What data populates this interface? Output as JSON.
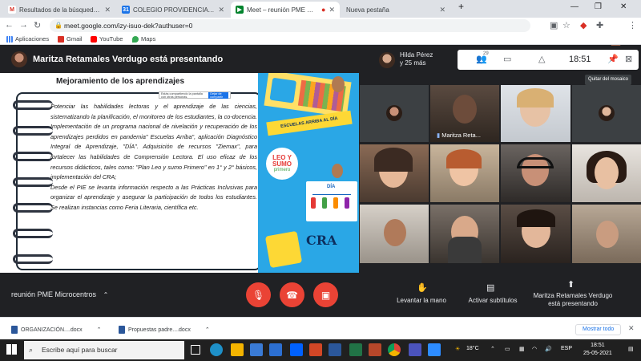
{
  "browser": {
    "tabs": [
      {
        "label": "Resultados de la búsqueda - eg...",
        "favicon": "M",
        "color": "#d93025",
        "active": false
      },
      {
        "label": "COLEGIO PROVIDENCIA - Calend...",
        "favicon": "31",
        "color": "#1a73e8",
        "active": false
      },
      {
        "label": "Meet – reunión PME Microce",
        "favicon": "▶",
        "color": "#00832d",
        "active": true
      },
      {
        "label": "Nueva pestaña",
        "favicon": "",
        "color": "#dadce0",
        "active": false
      }
    ],
    "new_tab": "+",
    "url": "meet.google.com/izy-isuo-dek?authuser=0",
    "bookmarks": [
      {
        "label": "Aplicaciones",
        "color": "#4285f4"
      },
      {
        "label": "Gmail",
        "color": "#d93025"
      },
      {
        "label": "YouTube",
        "color": "#ff0000"
      },
      {
        "label": "Maps",
        "color": "#34a853"
      }
    ]
  },
  "meet": {
    "presenter_banner": "Maritza Retamales Verdugo está presentando",
    "top_participant": {
      "name": "Hilda Pérez",
      "more": "y 25 más"
    },
    "people_count": "29",
    "clock": "18:51",
    "tooltip": "Quitar del mosaico",
    "tile_label": "Maritza Reta...",
    "meeting_name": "reunión PME Microcentros",
    "controls": {
      "raise_hand": "Levantar la mano",
      "captions": "Activar subtítulos",
      "presenting": "Maritza Retamales Verdugo está presentando"
    }
  },
  "slide": {
    "title": "Mejoramiento de los aprendizajes",
    "share_text": "Estás compartiendo la pantalla con otras personas.",
    "share_button": "Dejar de compartir",
    "paragraph_1": "Potenciar las habilidades lectoras y el aprendizaje de las ciencias, sistematizando la planificación, el monitoreo de los estudiantes, la co-docencia. Implementación de un programa nacional de nivelación y recuperación de los aprendizajes perdidos en pandemia\" Escuelas Arriba\", aplicación Diagnóstico Integral de Aprendizaje, \"DÍA\". Adquisición de recursos \"Ziemax\", para fortalecer las habilidades de Comprensión Lectora. El uso eficaz de los recursos didácticos, tales como: \"Plan Leo y sumo Primero\" en 1° y 2° básicos, implementación del CRA;",
    "paragraph_2": "Desde el PIE se levanta información respecto a las Prácticas Inclusivas para organizar el aprendizaje y asegurar la participación de todos los estudiantes. Se realizan instancias como Feria Literaria, científica etc.",
    "banner": "ESCUELAS ARRIBA AL DÍA",
    "leo_line1": "LEO Y",
    "leo_line2": "SUMO",
    "leo_line3": "primero",
    "dia_label": "DÍA",
    "cra_label": "CRA"
  },
  "downloads": {
    "items": [
      "ORGANIZACIÓN....docx",
      "Propuestas padre....docx"
    ],
    "show_all": "Mostrar todo"
  },
  "taskbar": {
    "search_placeholder": "Escribe aquí para buscar",
    "temperature": "18°C",
    "language": "ESP",
    "time": "18:51",
    "date": "25-05-2021"
  }
}
